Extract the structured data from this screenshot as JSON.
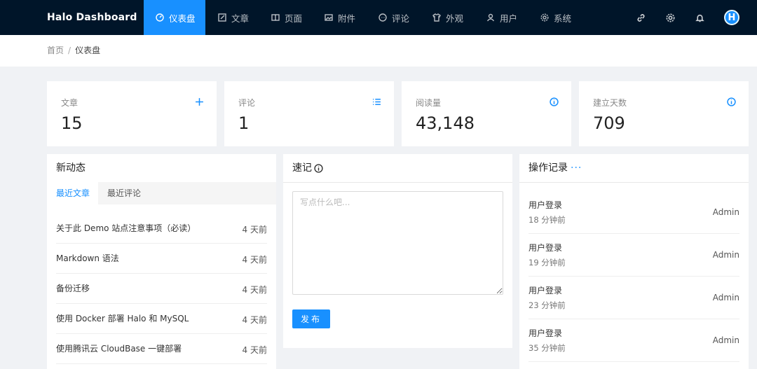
{
  "app": {
    "brand": "Halo  Dashboard"
  },
  "nav": [
    {
      "label": "仪表盘",
      "icon": "dashboard-icon",
      "active": true
    },
    {
      "label": "文章",
      "icon": "edit-icon"
    },
    {
      "label": "页面",
      "icon": "book-icon"
    },
    {
      "label": "附件",
      "icon": "picture-icon"
    },
    {
      "label": "评论",
      "icon": "message-icon"
    },
    {
      "label": "外观",
      "icon": "skin-icon"
    },
    {
      "label": "用户",
      "icon": "user-icon"
    },
    {
      "label": "系统",
      "icon": "setting-icon"
    }
  ],
  "header_icons": [
    "link-icon",
    "gear-icon",
    "bell-icon"
  ],
  "avatar_letter": "H",
  "breadcrumb": {
    "home": "首页",
    "sep": "/",
    "current": "仪表盘"
  },
  "stats": [
    {
      "label": "文章",
      "value": "15",
      "icon": "plus-icon"
    },
    {
      "label": "评论",
      "value": "1",
      "icon": "list-icon"
    },
    {
      "label": "阅读量",
      "value": "43,148",
      "icon": "info-icon"
    },
    {
      "label": "建立天数",
      "value": "709",
      "icon": "info-icon"
    }
  ],
  "activity": {
    "title": "新动态",
    "tabs": [
      "最近文章",
      "最近评论"
    ],
    "posts": [
      {
        "title": "关于此 Demo 站点注意事项（必读）",
        "time": "4 天前"
      },
      {
        "title": "Markdown 语法",
        "time": "4 天前"
      },
      {
        "title": "备份迁移",
        "time": "4 天前"
      },
      {
        "title": "使用 Docker 部署 Halo 和 MySQL",
        "time": "4 天前"
      },
      {
        "title": "使用腾讯云 CloudBase 一键部署",
        "time": "4 天前"
      }
    ]
  },
  "note": {
    "title": "速记",
    "placeholder": "写点什么吧...",
    "button": "发布"
  },
  "logs": {
    "title": "操作记录",
    "more": "···",
    "items": [
      {
        "action": "用户登录",
        "time": "18 分钟前",
        "user": "Admin"
      },
      {
        "action": "用户登录",
        "time": "19 分钟前",
        "user": "Admin"
      },
      {
        "action": "用户登录",
        "time": "23 分钟前",
        "user": "Admin"
      },
      {
        "action": "用户登录",
        "time": "35 分钟前",
        "user": "Admin"
      }
    ]
  },
  "colors": {
    "header_bg": "#001529",
    "accent": "#1890ff",
    "page_bg": "#f0f2f5"
  }
}
